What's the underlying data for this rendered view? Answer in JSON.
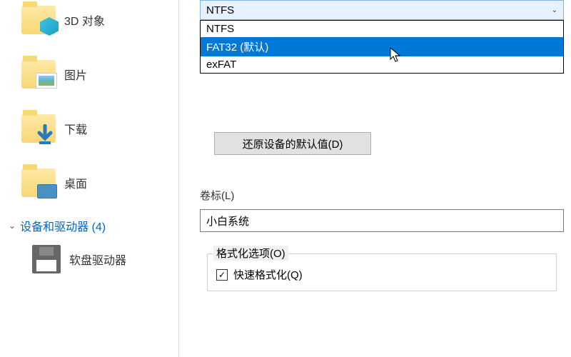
{
  "nav": {
    "items": [
      {
        "label": "3D 对象"
      },
      {
        "label": "图片"
      },
      {
        "label": "下载"
      },
      {
        "label": "桌面"
      }
    ],
    "section_title": "设备和驱动器 (4)",
    "floppy_label": "软盘驱动器"
  },
  "format_dialog": {
    "filesystem_selected": "NTFS",
    "filesystem_options": [
      "NTFS",
      "FAT32 (默认)",
      "exFAT"
    ],
    "restore_defaults": "还原设备的默认值(D)",
    "volume_label_caption": "卷标(L)",
    "volume_label_value": "小白系统",
    "format_options_caption": "格式化选项(O)",
    "quick_format": "快速格式化(Q)",
    "quick_format_checked": "✓"
  }
}
